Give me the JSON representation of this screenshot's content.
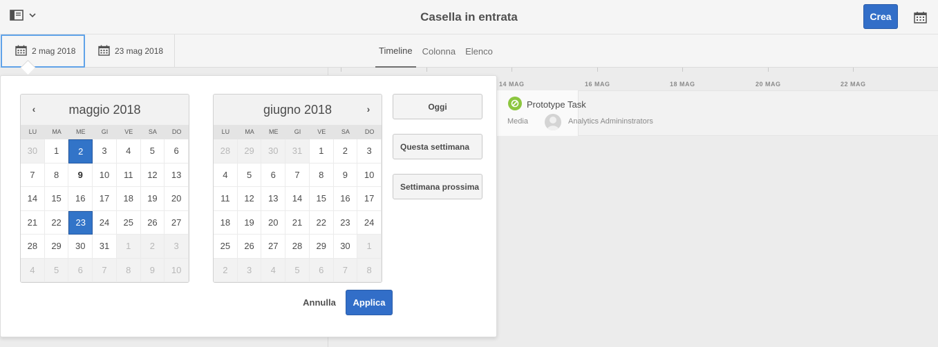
{
  "header": {
    "title": "Casella in entrata",
    "create_label": "Crea"
  },
  "toolbar": {
    "start_date": "2 mag 2018",
    "end_date": "23 mag 2018",
    "view_tabs": [
      {
        "label": "Timeline",
        "active": true
      },
      {
        "label": "Colonna",
        "active": false
      },
      {
        "label": "Elenco",
        "active": false
      }
    ]
  },
  "timeline": {
    "date_labels": [
      "14 MAG",
      "16 MAG",
      "18 MAG",
      "20 MAG",
      "22 MAG"
    ],
    "task": {
      "title": "Prototype Task",
      "type": "Media",
      "assignee": "Analytics Admininstrators",
      "status_color": "#8cc63f"
    }
  },
  "date_picker": {
    "weekdays": [
      "LU",
      "MA",
      "ME",
      "GI",
      "VE",
      "SA",
      "DO"
    ],
    "calendars": [
      {
        "month_label": "maggio 2018",
        "days": [
          {
            "d": "30",
            "out": true
          },
          {
            "d": "1"
          },
          {
            "d": "2",
            "sel": true
          },
          {
            "d": "3"
          },
          {
            "d": "4"
          },
          {
            "d": "5"
          },
          {
            "d": "6"
          },
          {
            "d": "7"
          },
          {
            "d": "8"
          },
          {
            "d": "9",
            "today": true
          },
          {
            "d": "10"
          },
          {
            "d": "11"
          },
          {
            "d": "12"
          },
          {
            "d": "13"
          },
          {
            "d": "14"
          },
          {
            "d": "15"
          },
          {
            "d": "16"
          },
          {
            "d": "17"
          },
          {
            "d": "18"
          },
          {
            "d": "19"
          },
          {
            "d": "20"
          },
          {
            "d": "21"
          },
          {
            "d": "22"
          },
          {
            "d": "23",
            "sel": true
          },
          {
            "d": "24"
          },
          {
            "d": "25"
          },
          {
            "d": "26"
          },
          {
            "d": "27"
          },
          {
            "d": "28"
          },
          {
            "d": "29"
          },
          {
            "d": "30"
          },
          {
            "d": "31"
          },
          {
            "d": "1",
            "out": true
          },
          {
            "d": "2",
            "out": true
          },
          {
            "d": "3",
            "out": true
          },
          {
            "d": "4",
            "out": true
          },
          {
            "d": "5",
            "out": true
          },
          {
            "d": "6",
            "out": true
          },
          {
            "d": "7",
            "out": true
          },
          {
            "d": "8",
            "out": true
          },
          {
            "d": "9",
            "out": true
          },
          {
            "d": "10",
            "out": true
          }
        ]
      },
      {
        "month_label": "giugno 2018",
        "days": [
          {
            "d": "28",
            "out": true
          },
          {
            "d": "29",
            "out": true
          },
          {
            "d": "30",
            "out": true
          },
          {
            "d": "31",
            "out": true
          },
          {
            "d": "1"
          },
          {
            "d": "2"
          },
          {
            "d": "3"
          },
          {
            "d": "4"
          },
          {
            "d": "5"
          },
          {
            "d": "6"
          },
          {
            "d": "7"
          },
          {
            "d": "8"
          },
          {
            "d": "9"
          },
          {
            "d": "10"
          },
          {
            "d": "11"
          },
          {
            "d": "12"
          },
          {
            "d": "13"
          },
          {
            "d": "14"
          },
          {
            "d": "15"
          },
          {
            "d": "16"
          },
          {
            "d": "17"
          },
          {
            "d": "18"
          },
          {
            "d": "19"
          },
          {
            "d": "20"
          },
          {
            "d": "21"
          },
          {
            "d": "22"
          },
          {
            "d": "23"
          },
          {
            "d": "24"
          },
          {
            "d": "25"
          },
          {
            "d": "26"
          },
          {
            "d": "27"
          },
          {
            "d": "28"
          },
          {
            "d": "29"
          },
          {
            "d": "30"
          },
          {
            "d": "1",
            "out": true
          },
          {
            "d": "2",
            "out": true
          },
          {
            "d": "3",
            "out": true
          },
          {
            "d": "4",
            "out": true
          },
          {
            "d": "5",
            "out": true
          },
          {
            "d": "6",
            "out": true
          },
          {
            "d": "7",
            "out": true
          },
          {
            "d": "8",
            "out": true
          }
        ]
      }
    ],
    "quick_buttons": [
      "Oggi",
      "Questa settimana",
      "Settimana prossima"
    ],
    "cancel_label": "Annulla",
    "apply_label": "Applica"
  },
  "colors": {
    "accent": "#326ec8",
    "focus": "#5fa2e8"
  }
}
